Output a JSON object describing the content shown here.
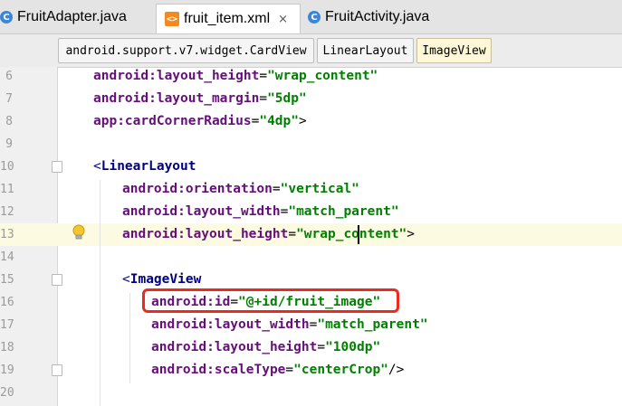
{
  "tabs": [
    {
      "label": "FruitAdapter.java",
      "icon": "java-class-icon",
      "active": false
    },
    {
      "label": "fruit_item.xml",
      "icon": "xml-file-icon",
      "active": true,
      "close": "×"
    },
    {
      "label": "FruitActivity.java",
      "icon": "java-class-icon",
      "active": false
    }
  ],
  "breadcrumbs": [
    "android.support.v7.widget.CardView",
    "LinearLayout",
    "ImageView"
  ],
  "code_lines": [
    {
      "num": "6",
      "indent": 0,
      "tokens": [
        [
          "attr",
          "android:layout_height"
        ],
        [
          "pun",
          "="
        ],
        [
          "val",
          "\"wrap_content\""
        ]
      ]
    },
    {
      "num": "7",
      "indent": 0,
      "tokens": [
        [
          "attr",
          "android:layout_margin"
        ],
        [
          "pun",
          "="
        ],
        [
          "val",
          "\"5dp\""
        ]
      ]
    },
    {
      "num": "8",
      "indent": 0,
      "tokens": [
        [
          "attr",
          "app:cardCornerRadius"
        ],
        [
          "pun",
          "="
        ],
        [
          "val",
          "\"4dp\""
        ],
        [
          "pun",
          ">"
        ]
      ]
    },
    {
      "num": "9",
      "indent": 0,
      "tokens": []
    },
    {
      "num": "10",
      "indent": 0,
      "tokens": [
        [
          "tag",
          "<"
        ],
        [
          "tagname",
          "LinearLayout"
        ]
      ]
    },
    {
      "num": "11",
      "indent": 1,
      "tokens": [
        [
          "attr",
          "android:orientation"
        ],
        [
          "pun",
          "="
        ],
        [
          "val",
          "\"vertical\""
        ]
      ]
    },
    {
      "num": "12",
      "indent": 1,
      "tokens": [
        [
          "attr",
          "android:layout_width"
        ],
        [
          "pun",
          "="
        ],
        [
          "val",
          "\"match_parent\""
        ]
      ]
    },
    {
      "num": "13",
      "indent": 1,
      "tokens": [
        [
          "attr",
          "android:layout_height"
        ],
        [
          "pun",
          "="
        ],
        [
          "val",
          "\"wrap_content\""
        ],
        [
          "pun",
          ">"
        ]
      ]
    },
    {
      "num": "14",
      "indent": 0,
      "tokens": []
    },
    {
      "num": "15",
      "indent": 1,
      "tokens": [
        [
          "tag",
          "<"
        ],
        [
          "tagname",
          "ImageView"
        ]
      ]
    },
    {
      "num": "16",
      "indent": 2,
      "tokens": [
        [
          "attr",
          "android:id"
        ],
        [
          "pun",
          "="
        ],
        [
          "val",
          "\"@+id/fruit_image\""
        ]
      ]
    },
    {
      "num": "17",
      "indent": 2,
      "tokens": [
        [
          "attr",
          "android:layout_width"
        ],
        [
          "pun",
          "="
        ],
        [
          "val",
          "\"match_parent\""
        ]
      ]
    },
    {
      "num": "18",
      "indent": 2,
      "tokens": [
        [
          "attr",
          "android:layout_height"
        ],
        [
          "pun",
          "="
        ],
        [
          "val",
          "\"100dp\""
        ]
      ]
    },
    {
      "num": "19",
      "indent": 2,
      "tokens": [
        [
          "attr",
          "android:scaleType"
        ],
        [
          "pun",
          "="
        ],
        [
          "val",
          "\"centerCrop\""
        ],
        [
          "pun",
          "/>"
        ]
      ]
    },
    {
      "num": "20",
      "indent": 0,
      "tokens": []
    }
  ],
  "current_line": "13",
  "highlighted_line": "16",
  "colors": {
    "attribute": "#660e7a",
    "string_value": "#008000",
    "tag": "#000080",
    "highlight_box": "#ea2b1d",
    "current_line_bg": "#fcfae0"
  }
}
